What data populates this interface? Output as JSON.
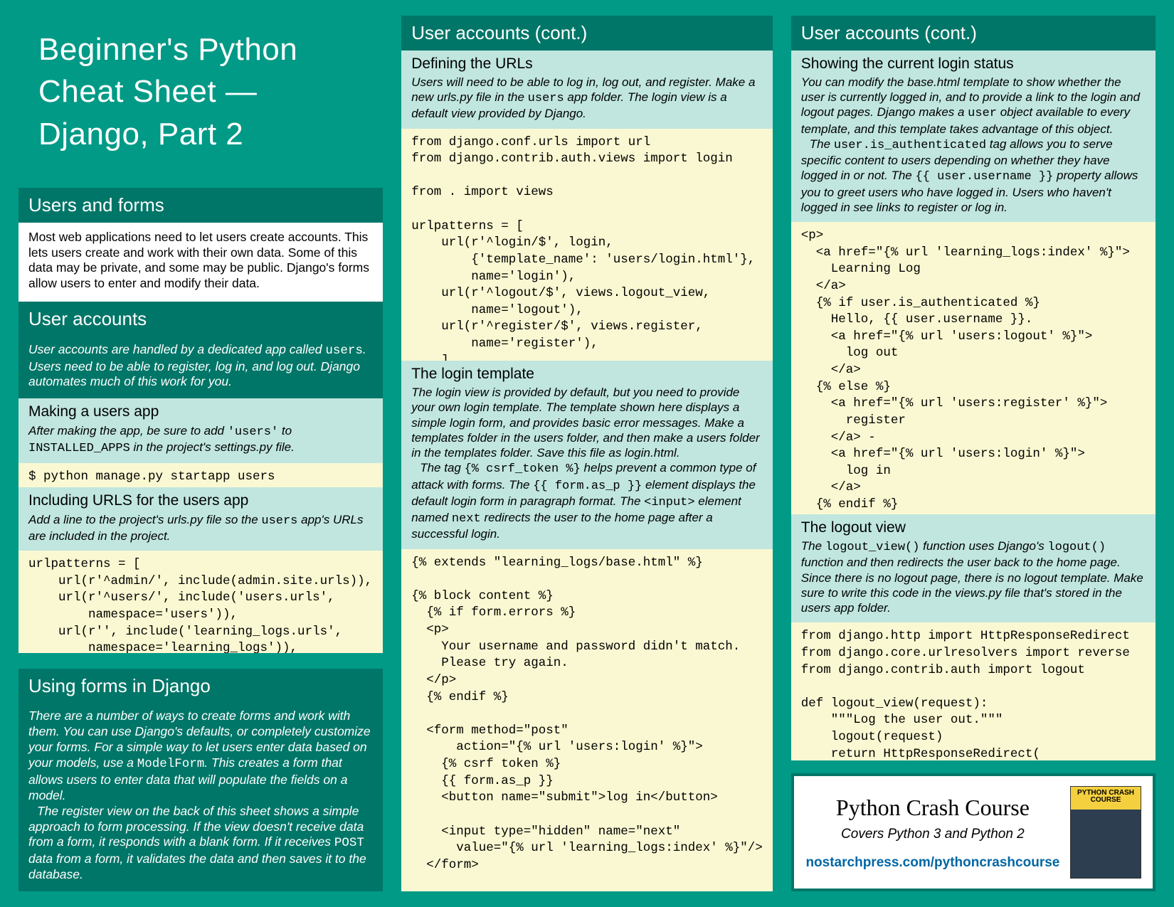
{
  "title": "Beginner's Python Cheat Sheet — Django, Part 2",
  "col1": {
    "h1": "Users and forms",
    "intro1": "Most web applications need to let users create accounts. This lets users create and work with their own data. Some of this data may be private, and some may be public. Django's forms allow users to enter and modify their data.",
    "h2": "User accounts",
    "intro2a": "User accounts are handled by a dedicated app called ",
    "intro2_mono": "users",
    "intro2b": ". Users need to be able to register, log in, and log out. Django automates much of this work for you.",
    "s1_head": "Making a users app",
    "s1_text_a": "After making the app, be sure to add ",
    "s1_mono1": "'users'",
    "s1_text_b": " to ",
    "s1_mono2": "INSTALLED_APPS",
    "s1_text_c": " in the project's settings.py file.",
    "code1": "$ python manage.py startapp users",
    "s2_head": "Including URLS for the users app",
    "s2_text_a": "Add a line to the project's urls.py file so the ",
    "s2_mono": "users",
    "s2_text_b": " app's URLs are included in the project.",
    "code2": "urlpatterns = [\n    url(r'^admin/', include(admin.site.urls)),\n    url(r'^users/', include('users.urls',\n        namespace='users')),\n    url(r'', include('learning_logs.urls',\n        namespace='learning_logs')),\n]",
    "h3": "Using forms in Django",
    "intro3a": "There are a number of ways to create forms and work with them. You can use Django's defaults, or completely customize your forms. For a simple way to let users enter data based on your models, use a ",
    "intro3_mono": "ModelForm",
    "intro3b": ". This creates a form that allows users to enter data that will populate the fields on a model.",
    "intro3c_a": "The register view on the back of this sheet shows a simple approach to form processing. If the view doesn't receive data from a form, it responds with a blank form. If it receives ",
    "intro3c_mono": "POST",
    "intro3c_b": " data from a form, it validates the data and then saves it to the database."
  },
  "col2": {
    "h1": "User accounts (cont.)",
    "s1_head": "Defining the URLs",
    "s1_text_a": "Users will need to be able to log in, log out, and register. Make a new urls.py file in the ",
    "s1_mono": "users",
    "s1_text_b": " app folder. The login view is a default view provided by Django.",
    "code1": "from django.conf.urls import url\nfrom django.contrib.auth.views import login\n\nfrom . import views\n\nurlpatterns = [\n    url(r'^login/$', login,\n        {'template_name': 'users/login.html'},\n        name='login'),\n    url(r'^logout/$', views.logout_view,\n        name='logout'),\n    url(r'^register/$', views.register,\n        name='register'),\n    ]",
    "s2_head": "The login template",
    "s2_text_a": "The login view is provided by default, but you need to provide your own login template. The template shown here displays a simple login form, and provides basic error messages. Make a templates folder in the users folder, and then make a users folder in the templates folder. Save this file as login.html.",
    "s2_text_b1": "The tag ",
    "s2_m1": "{% csrf_token %}",
    "s2_text_b2": " helps prevent a common type of attack with forms. The ",
    "s2_m2": "{{ form.as_p }}",
    "s2_text_b3": " element displays the default login form in paragraph format. The ",
    "s2_m3": "<input>",
    "s2_text_b4": " element named ",
    "s2_m4": "next",
    "s2_text_b5": " redirects the user to the home page after a successful login.",
    "code2": "{% extends \"learning_logs/base.html\" %}\n\n{% block content %}\n  {% if form.errors %}\n  <p>\n    Your username and password didn't match.\n    Please try again.\n  </p>\n  {% endif %}\n\n  <form method=\"post\"\n      action=\"{% url 'users:login' %}\">\n    {% csrf token %}\n    {{ form.as_p }}\n    <button name=\"submit\">log in</button>\n\n    <input type=\"hidden\" name=\"next\"\n      value=\"{% url 'learning_logs:index' %}\"/>\n  </form>\n\n{% endblock content %}"
  },
  "col3": {
    "h1": "User accounts (cont.)",
    "s1_head": "Showing the current login status",
    "s1_text_a1": "You can modify the base.html template to show whether the user is currently logged in, and to provide a link to the login and logout pages. Django makes a ",
    "s1_m1": "user",
    "s1_text_a2": " object available to every template, and this template takes advantage of this object.",
    "s1_text_b1": "The ",
    "s1_m2": "user.is_authenticated",
    "s1_text_b2": " tag allows you to serve specific content to users depending on whether they have logged in or not. The ",
    "s1_m3": "{{ user.username }}",
    "s1_text_b3": " property allows you to greet users who have logged in. Users who haven't logged in see links to register or log in.",
    "code1": "<p>\n  <a href=\"{% url 'learning_logs:index' %}\">\n    Learning Log\n  </a>\n  {% if user.is_authenticated %}\n    Hello, {{ user.username }}.\n    <a href=\"{% url 'users:logout' %}\">\n      log out\n    </a>\n  {% else %}\n    <a href=\"{% url 'users:register' %}\">\n      register\n    </a> -\n    <a href=\"{% url 'users:login' %}\">\n      log in\n    </a>\n  {% endif %}\n</p>\n\n{% block content %}{% endblock content %}",
    "s2_head": "The logout view",
    "s2_text_a": "The ",
    "s2_m1": "logout_view()",
    "s2_text_b": " function uses Django's ",
    "s2_m2": "logout()",
    "s2_text_c": " function and then redirects the user back to the home page. Since there is no logout page, there is no logout template. Make sure to write this code in the views.py file that's stored in the users app folder.",
    "code2": "from django.http import HttpResponseRedirect\nfrom django.core.urlresolvers import reverse\nfrom django.contrib.auth import logout\n\ndef logout_view(request):\n    \"\"\"Log the user out.\"\"\"\n    logout(request)\n    return HttpResponseRedirect(\n        reverse('learning_logs:index'))"
  },
  "promo": {
    "title": "Python Crash Course",
    "sub": "Covers Python 3 and Python 2",
    "link": "nostarchpress.com/pythoncrashcourse",
    "cover": "PYTHON CRASH COURSE"
  }
}
